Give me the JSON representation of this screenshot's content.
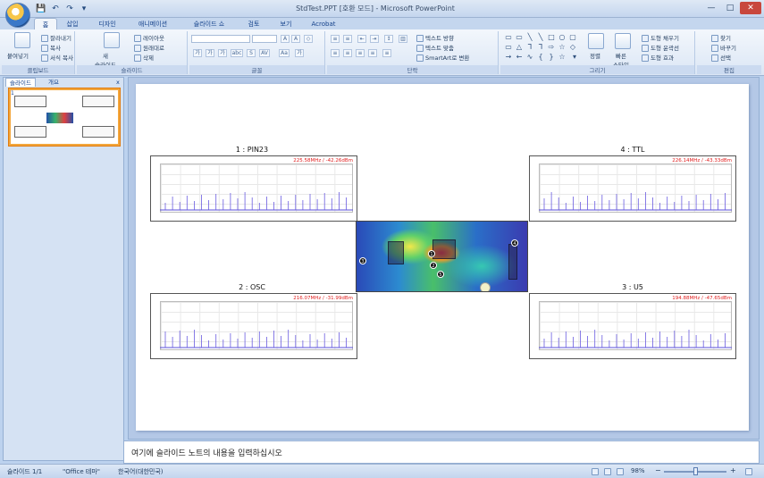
{
  "window": {
    "title": "StdTest.PPT [호환 모드] - Microsoft PowerPoint",
    "controls": {
      "minimize": "—",
      "maximize": "□",
      "close": "✕"
    }
  },
  "quick_access": {
    "save": "💾",
    "undo": "↶",
    "redo": "↷",
    "customize": "▾"
  },
  "ribbon_tabs": [
    {
      "label": "홈",
      "active": true
    },
    {
      "label": "삽입"
    },
    {
      "label": "디자인"
    },
    {
      "label": "애니메이션"
    },
    {
      "label": "슬라이드 쇼"
    },
    {
      "label": "검토"
    },
    {
      "label": "보기"
    },
    {
      "label": "Acrobat"
    }
  ],
  "ribbon": {
    "clipboard": {
      "paste": "붙여넣기",
      "cut": "잘라내기",
      "copy": "복사",
      "format_painter": "서식 복사",
      "label": "클립보드"
    },
    "slides": {
      "new_slide": "새\n슬라이드",
      "layout": "레이아웃",
      "reset": "원래대로",
      "delete": "삭제",
      "label": "슬라이드"
    },
    "font": {
      "label": "글꼴",
      "buttons": [
        "가",
        "가",
        "가",
        "abc",
        "S",
        "AV",
        "Aa",
        "가"
      ]
    },
    "paragraph": {
      "text_direction": "텍스트 방향",
      "align_text": "텍스트 맞춤",
      "smartart": "SmartArt로 변환",
      "label": "단락"
    },
    "drawing": {
      "arrange": "정렬",
      "quick_styles": "빠른\n스타일",
      "shape_fill": "도형 채우기",
      "shape_outline": "도형 윤곽선",
      "shape_effects": "도형 효과",
      "label": "그리기"
    },
    "editing": {
      "find": "찾기",
      "replace": "바꾸기",
      "select": "선택",
      "label": "편집"
    }
  },
  "left_panel": {
    "tabs": [
      "슬라이드",
      "개요"
    ],
    "close": "x",
    "slide_number": "1"
  },
  "slide": {
    "charts": [
      {
        "title": "1 : PIN23",
        "marker": "225.58MHz / -42.26dBm"
      },
      {
        "title": "4 : TTL",
        "marker": "226.14MHz / -43.33dBm"
      },
      {
        "title": "2 : OSC",
        "marker": "216.07MHz / -31.99dBm"
      },
      {
        "title": "3 : U5",
        "marker": "194.88MHz / -47.65dBm"
      }
    ],
    "thermal_markers": [
      "1",
      "2",
      "3",
      "4",
      "5"
    ]
  },
  "notes": {
    "text": "여기에 슬라이드 노트의 내용을 입력하십시오"
  },
  "status": {
    "slide": "슬라이드 1/1",
    "theme": "\"Office 테마\"",
    "language": "한국어(대한민국)",
    "zoom": "98%"
  }
}
